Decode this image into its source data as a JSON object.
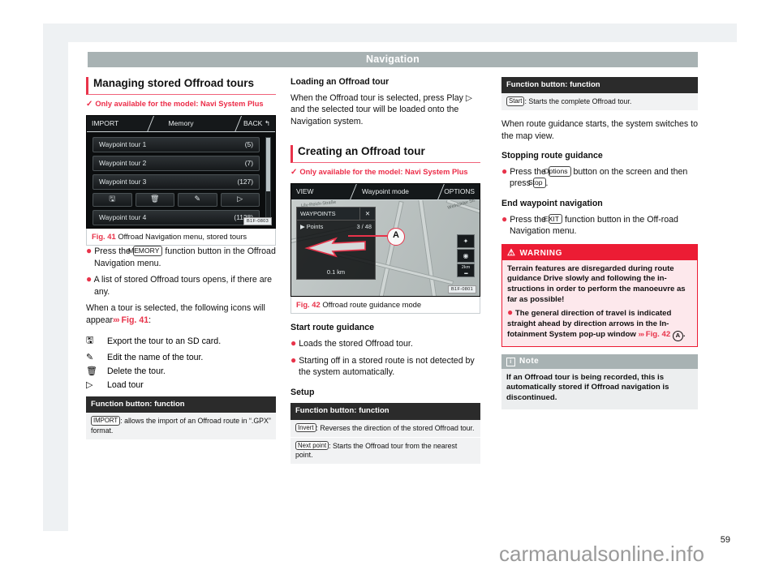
{
  "header": {
    "title": "Navigation"
  },
  "page_number": "59",
  "watermark": "carmanualsonline.info",
  "left": {
    "section_title": "Managing stored Offroad tours",
    "availability": "Only available for the model: Navi System Plus",
    "availability_tick": "✓",
    "figure": {
      "screen": {
        "top_left": "IMPORT",
        "top_center": "Memory",
        "top_right": "BACK",
        "back_icon": "↰",
        "rows": [
          {
            "name": "Waypoint tour 1",
            "count": "(5)"
          },
          {
            "name": "Waypoint tour 2",
            "count": "(7)"
          },
          {
            "name": "Waypoint tour 3",
            "count": "(127)"
          },
          {
            "name": "Waypoint tour 4",
            "count": "(1128)"
          }
        ],
        "icon_buttons": [
          "save-icon",
          "trash-icon",
          "pencil-icon",
          "play-icon"
        ],
        "icon_glyphs": [
          "🖫",
          "🗑",
          "✎",
          "▷"
        ],
        "code": "B1F-0803"
      },
      "caption_figno": "Fig. 41",
      "caption_text": "Offroad Navigation menu, stored tours"
    },
    "bullet_1_pre": "Press the",
    "bullet_1_key": "MEMORY",
    "bullet_1_post": "function button in the Offroad Navigation menu.",
    "bullet_2": "A list of stored Offroad tours opens, if there are any.",
    "para_1_pre": "When a tour is selected, the following icons will appear",
    "para_1_chev": "›››",
    "para_1_ref": "Fig. 41",
    "para_1_post": ":",
    "icon_list": [
      {
        "glyph": "🖫",
        "icon": "save-icon",
        "text": "Export the tour to an SD card."
      },
      {
        "glyph": "✎",
        "icon": "pencil-icon",
        "text": "Edit the name of the tour."
      },
      {
        "glyph": "🗑",
        "icon": "trash-icon",
        "text": "Delete the tour."
      },
      {
        "glyph": "▷",
        "icon": "play-icon",
        "text": "Load tour"
      }
    ],
    "table": {
      "head": "Function button: function",
      "rows": [
        {
          "key": "IMPORT",
          "text": ": allows the import of an Offroad route in “.GPX” format."
        }
      ]
    }
  },
  "middle": {
    "heading_1": "Loading an Offroad tour",
    "para_1": "When the Offroad tour is selected, press Play ▷ and the selected tour will be loaded onto the Navigation system.",
    "section_title": "Creating an Offroad tour",
    "availability": "Only available for the model: Navi System Plus",
    "availability_tick": "✓",
    "figure": {
      "map": {
        "top_left": "VIEW",
        "top_center": "Waypoint mode",
        "top_right": "OPTIONS",
        "street_label_1": "Lily-Reich-Straße",
        "street_label_2": "Weihbilder Str.",
        "panel_title": "WAYPOINTS",
        "panel_close": "✕",
        "points_label": "▶ Points",
        "points_count": "3 / 48",
        "distance": "0.1 km",
        "callout": "A",
        "controls": [
          "compass-icon",
          "target-icon",
          "zoom-scale"
        ],
        "scale_label": "2km",
        "code": "B1F-0801"
      },
      "caption_figno": "Fig. 42",
      "caption_text": "Offroad route guidance mode"
    },
    "heading_2": "Start route guidance",
    "bullet_1": "Loads the stored Offroad tour.",
    "bullet_2": "Starting off in a stored route is not detected by the system automatically.",
    "heading_3": "Setup",
    "table": {
      "head": "Function button: function",
      "rows": [
        {
          "key": "Invert",
          "text": ": Reverses the direction of the stored Offroad tour."
        },
        {
          "key": "Next point",
          "text": ": Starts the Offroad tour from the nearest point."
        }
      ]
    }
  },
  "right": {
    "table": {
      "head": "Function button: function",
      "rows": [
        {
          "key": "Start",
          "text": ": Starts the complete Offroad tour."
        }
      ]
    },
    "para_1": "When route guidance starts, the system switches to the map view.",
    "heading_1": "Stopping route guidance",
    "bullet_1_pre": "Press the",
    "bullet_1_key": "Options",
    "bullet_1_mid": "button on the screen and then press",
    "bullet_1_key2": "Stop",
    "bullet_1_post": ".",
    "heading_2": "End waypoint navigation",
    "bullet_2_pre": "Press the",
    "bullet_2_key": "EXIT",
    "bullet_2_post": "function button in the Off-road Navigation menu.",
    "warning": {
      "title": "WARNING",
      "icon": "warning-triangle-icon",
      "para_1": "Terrain features are disregarded during route guidance Drive slowly and following the in-structions in order to perform the manoeuvre as far as possible!",
      "bullet_1_pre": "The general direction of travel is indicated straight ahead by direction arrows in the In-fotainment System pop-up window",
      "bullet_1_chev": "›››",
      "bullet_1_ref": "Fig. 42",
      "bullet_1_circle": "A",
      "bullet_1_post": "."
    },
    "note": {
      "title": "Note",
      "icon": "info-icon",
      "text": "If an Offroad tour is being recorded, this is automatically stored if Offroad navigation is discontinued."
    }
  }
}
